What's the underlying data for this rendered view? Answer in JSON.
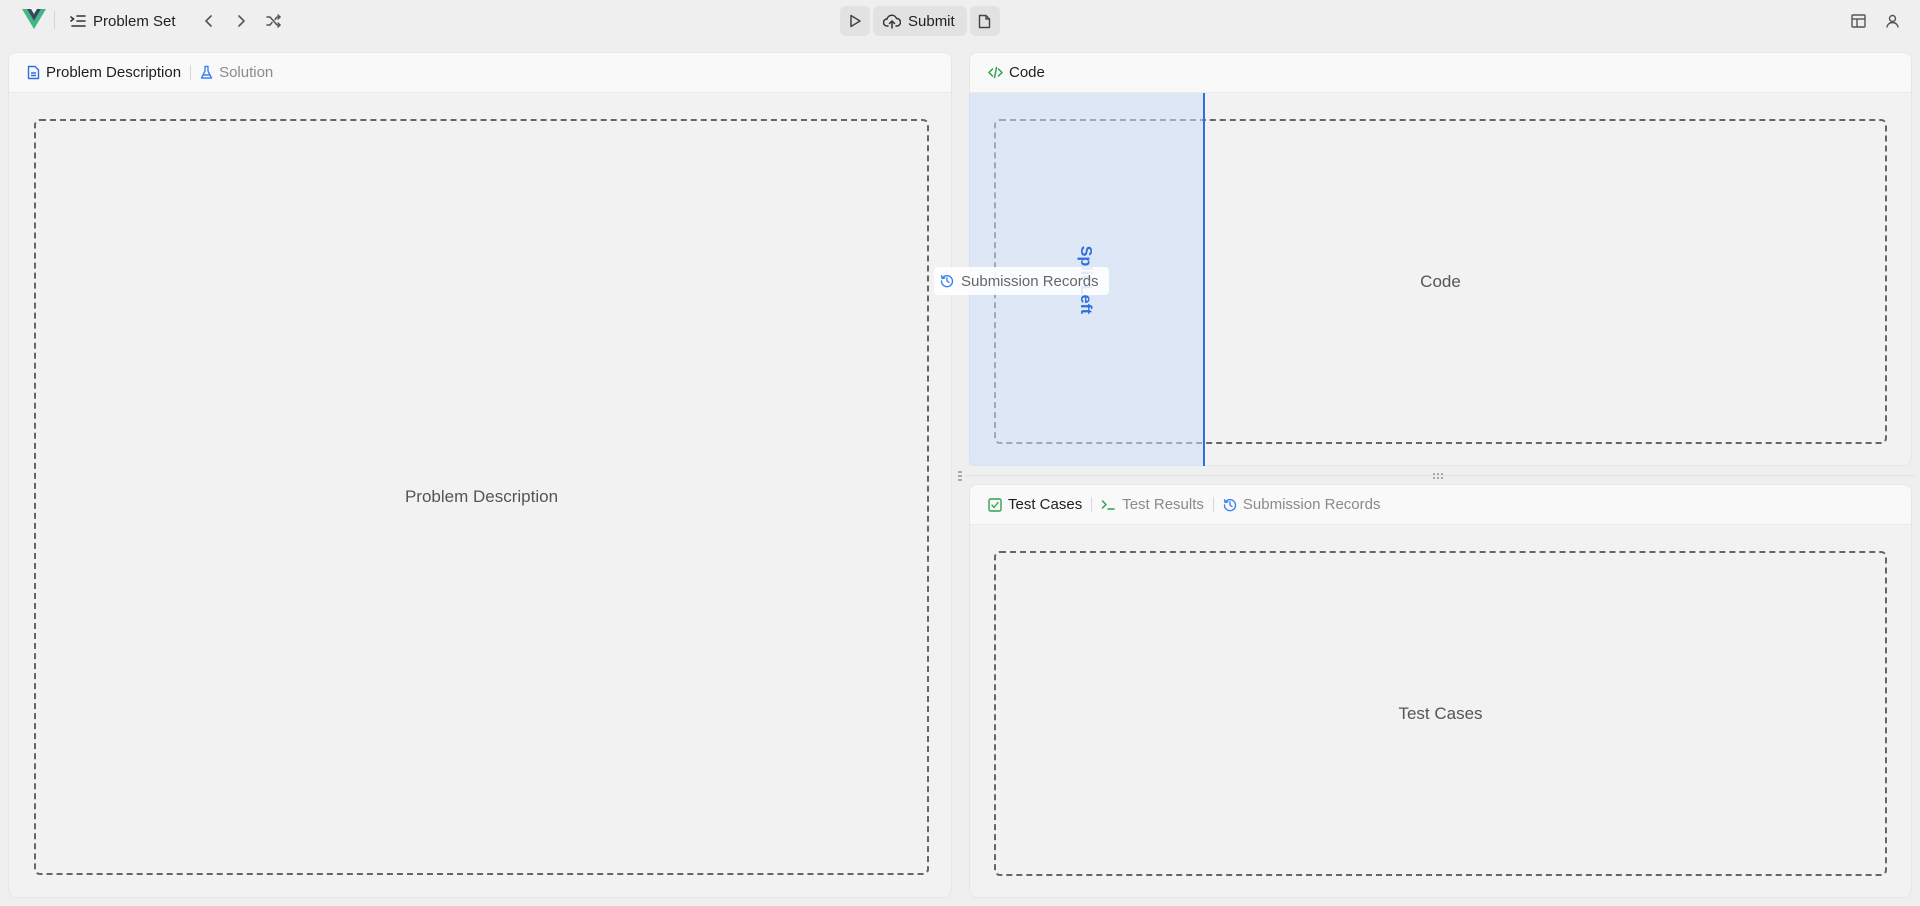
{
  "header": {
    "problem_set_label": "Problem Set",
    "submit_label": "Submit"
  },
  "left_panel": {
    "tabs": [
      {
        "label": "Problem Description",
        "icon": "document-icon",
        "active": true
      },
      {
        "label": "Solution",
        "icon": "flask-icon",
        "active": false
      }
    ],
    "placeholder": "Problem Description"
  },
  "code_panel": {
    "tabs": [
      {
        "label": "Code",
        "icon": "code-icon",
        "active": true
      }
    ],
    "placeholder": "Code"
  },
  "tests_panel": {
    "tabs": [
      {
        "label": "Test Cases",
        "icon": "checkbox-icon",
        "active": true
      },
      {
        "label": "Test Results",
        "icon": "terminal-icon",
        "active": false
      },
      {
        "label": "Submission Records",
        "icon": "history-icon",
        "active": false
      }
    ],
    "placeholder": "Test Cases"
  },
  "drag_overlay": {
    "drop_label": "Split Left",
    "ghost_label": "Submission Records"
  },
  "colors": {
    "accent_blue": "#2f6fdc",
    "accent_green": "#2ea44f",
    "logo_green": "#41b883",
    "logo_dark": "#35495e"
  }
}
